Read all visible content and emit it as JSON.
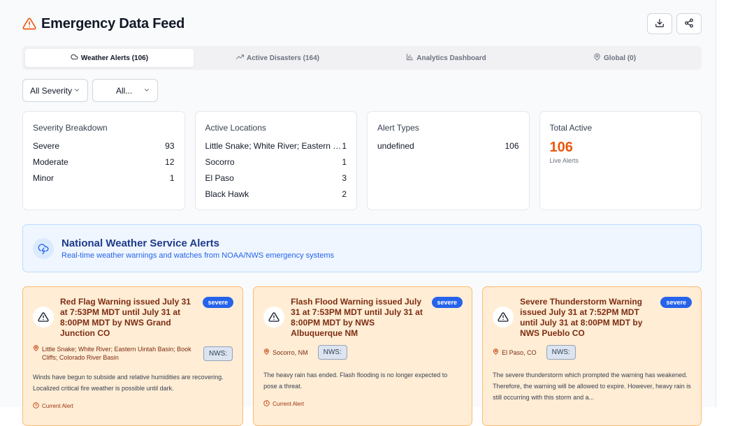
{
  "header": {
    "title": "Emergency Data Feed",
    "actions": [
      "download-icon",
      "share-icon"
    ]
  },
  "tabs": [
    {
      "label": "Weather Alerts (106)",
      "icon": "cloud-icon",
      "active": true
    },
    {
      "label": "Active Disasters (164)",
      "icon": "trending-icon",
      "active": false
    },
    {
      "label": "Analytics Dashboard",
      "icon": "bar-chart-icon",
      "active": false
    },
    {
      "label": "Global (0)",
      "icon": "pin-icon",
      "active": false
    }
  ],
  "filters": {
    "severity": "All Severity",
    "second": "All..."
  },
  "stats": {
    "severity": {
      "title": "Severity Breakdown",
      "rows": [
        {
          "label": "Severe",
          "value": "93"
        },
        {
          "label": "Moderate",
          "value": "12"
        },
        {
          "label": "Minor",
          "value": "1"
        }
      ]
    },
    "locations": {
      "title": "Active Locations",
      "rows": [
        {
          "label": "Little Snake; White River; Eastern Uin...",
          "value": "1"
        },
        {
          "label": "Socorro",
          "value": "1"
        },
        {
          "label": "El Paso",
          "value": "3"
        },
        {
          "label": "Black Hawk",
          "value": "2"
        }
      ]
    },
    "types": {
      "title": "Alert Types",
      "rows": [
        {
          "label": "undefined",
          "value": "106"
        }
      ]
    },
    "total": {
      "title": "Total Active",
      "value": "106",
      "sub": "Live Alerts"
    }
  },
  "banner": {
    "title": "National Weather Service Alerts",
    "subtitle": "Real-time weather warnings and watches from NOAA/NWS emergency systems"
  },
  "alerts": [
    {
      "title": "Red Flag Warning issued July 31 at 7:53PM MDT until July 31 at 8:00PM MDT by NWS Grand Junction CO",
      "badge": "severe",
      "location": "Little Snake; White River; Eastern Uintah Basin; Book Cliffs; Colorado River Basin",
      "source": "NWS:",
      "description": "Winds have begun to subside and relative humidities are recovering. Localized critical fire weather is possible until dark.",
      "footer": "Current Alert"
    },
    {
      "title": "Flash Flood Warning issued July 31 at 7:53PM MDT until July 31 at 8:00PM MDT by NWS Albuquerque NM",
      "badge": "severe",
      "location": "Socorro, NM",
      "source": "NWS:",
      "description": "The heavy rain has ended. Flash flooding is no longer expected to pose a threat.",
      "footer": "Current Alert"
    },
    {
      "title": "Severe Thunderstorm Warning issued July 31 at 7:52PM MDT until July 31 at 8:00PM MDT by NWS Pueblo CO",
      "badge": "severe",
      "location": "El Paso, CO",
      "source": "NWS:",
      "description": "The severe thunderstorm which prompted the warning has weakened. Therefore, the warning will be allowed to expire. However, heavy rain is still occurring with this storm and a...",
      "footer": ""
    }
  ],
  "colors": {
    "accent": "#ea580c",
    "badge": "#2563eb",
    "alert_bg": "#ffedd5"
  }
}
